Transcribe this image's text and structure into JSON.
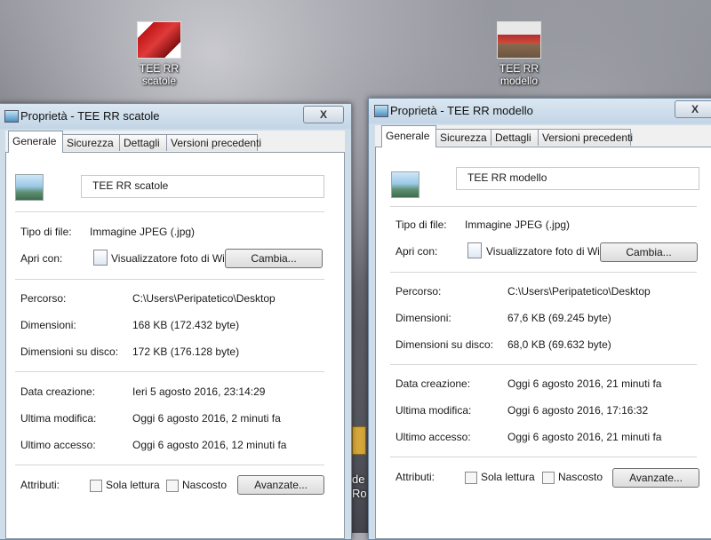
{
  "desktop": {
    "icons": [
      {
        "line1": "TEE RR",
        "line2": "scatole"
      },
      {
        "line1": "TEE RR",
        "line2": "modello"
      }
    ],
    "partial_text": [
      "de",
      "Ro"
    ]
  },
  "windows": [
    {
      "title": "Proprietà - TEE RR scatole",
      "close": "X",
      "tabs": [
        "Generale",
        "Sicurezza",
        "Dettagli",
        "Versioni precedenti"
      ],
      "file_name": "TEE RR scatole",
      "type_label": "Tipo di file:",
      "type_value": "Immagine JPEG (.jpg)",
      "open_label": "Apri con:",
      "open_value": "Visualizzatore foto di Wi",
      "change_button": "Cambia...",
      "path_label": "Percorso:",
      "path_value": "C:\\Users\\Peripatetico\\Desktop",
      "size_label": "Dimensioni:",
      "size_value": "168 KB (172.432 byte)",
      "disk_label": "Dimensioni su disco:",
      "disk_value": "172 KB (176.128 byte)",
      "created_label": "Data creazione:",
      "created_value": "Ieri 5 agosto 2016, 23:14:29",
      "modified_label": "Ultima modifica:",
      "modified_value": "Oggi 6 agosto 2016, 2 minuti fa",
      "accessed_label": "Ultimo accesso:",
      "accessed_value": "Oggi 6 agosto 2016, 12 minuti fa",
      "attr_label": "Attributi:",
      "readonly_label": "Sola lettura",
      "hidden_label": "Nascosto",
      "advanced_button": "Avanzate..."
    },
    {
      "title": "Proprietà - TEE RR modello",
      "close": "X",
      "tabs": [
        "Generale",
        "Sicurezza",
        "Dettagli",
        "Versioni precedenti"
      ],
      "file_name": "TEE RR modello",
      "type_label": "Tipo di file:",
      "type_value": "Immagine JPEG (.jpg)",
      "open_label": "Apri con:",
      "open_value": "Visualizzatore foto di Wi",
      "change_button": "Cambia...",
      "path_label": "Percorso:",
      "path_value": "C:\\Users\\Peripatetico\\Desktop",
      "size_label": "Dimensioni:",
      "size_value": "67,6 KB (69.245 byte)",
      "disk_label": "Dimensioni su disco:",
      "disk_value": "68,0 KB (69.632 byte)",
      "created_label": "Data creazione:",
      "created_value": "Oggi 6 agosto 2016, 21 minuti fa",
      "modified_label": "Ultima modifica:",
      "modified_value": "Oggi 6 agosto 2016, 17:16:32",
      "accessed_label": "Ultimo accesso:",
      "accessed_value": "Oggi 6 agosto 2016, 21 minuti fa",
      "attr_label": "Attributi:",
      "readonly_label": "Sola lettura",
      "hidden_label": "Nascosto",
      "advanced_button": "Avanzate..."
    }
  ]
}
